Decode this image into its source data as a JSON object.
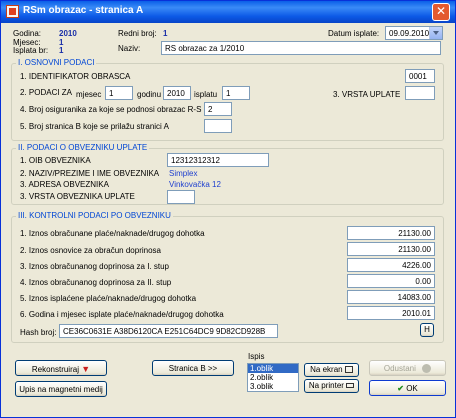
{
  "window": {
    "title": "RSm obrazac - stranica A",
    "close_label": "✕"
  },
  "header": {
    "godina_label": "Godina:",
    "godina_value": "2010",
    "mjesec_label": "Mjesec:",
    "mjesec_value": "1",
    "isplata_label": "Isplata br:",
    "isplata_value": "1",
    "redni_label": "Redni broj:",
    "redni_value": "1",
    "naziv_label": "Naziv:",
    "naziv_value": "RS obrazac za 1/2010",
    "datum_label": "Datum isplate:",
    "datum_value": "09.09.2010"
  },
  "section1": {
    "title": "I. OSNOVNI PODACI",
    "identifikator_label": "1. IDENTIFIKATOR OBRASCA",
    "identifikator_value": "0001",
    "podaci_label": "2. PODACI ZA",
    "mjesec_label": "mjesec",
    "mjesec_value": "1",
    "godinu_label": "godinu",
    "godinu_value": "2010",
    "isplatu_label": "isplatu",
    "isplatu_value": "1",
    "vrsta_label": "3. VRSTA UPLATE",
    "vrsta_value": "",
    "osiguranika_label": "4. Broj osiguranika za koje se podnosi obrazac R-S",
    "osiguranika_value": "2",
    "stranica_b_label": "5. Broj stranica B koje se prilažu stranici A",
    "stranica_b_value": ""
  },
  "section2": {
    "title": "II. PODACI O OBVEZNIKU UPLATE",
    "oib_label": "1. OIB OBVEZNIKA",
    "oib_value": "12312312312",
    "naziv_label": "2. NAZIV/PREZIME I IME OBVEZNIKA",
    "naziv_value": "Simplex",
    "adresa_label": "3. ADRESA OBVEZNIKA",
    "adresa_value": "Vinkovačka 12",
    "vrsta_label": "3. VRSTA OBVEZNIKA UPLATE",
    "vrsta_value": ""
  },
  "section3": {
    "title": "III. KONTROLNI PODACI PO OBVEZNIKU",
    "rows": [
      {
        "label": "1.   Iznos obračunane plaće/naknade/drugog dohotka",
        "value": "21130.00"
      },
      {
        "label": "2.   Iznos osnovice za obračun doprinosa",
        "value": "21130.00"
      },
      {
        "label": "3.   Iznos obračunanog doprinosa za I. stup",
        "value": "4226.00"
      },
      {
        "label": "4.   Iznos obračunanog doprinosa za II. stup",
        "value": "0.00"
      },
      {
        "label": "5.   Iznos isplaćene plaće/naknade/drugog dohotka",
        "value": "14083.00"
      },
      {
        "label": "6.   Godina i mjesec isplate plaće/naknade/drugog dohotka",
        "value": "2010.01"
      }
    ],
    "hash_label": "Hash broj:",
    "hash_value": "CE36C0631E A38D6120CA E251C64DC9 9D82CD928B",
    "hash_button": "H"
  },
  "footer": {
    "rekonstruiraj": "Rekonstruiraj",
    "upis": "Upis na magnetni medij",
    "stranica_b": "Stranica B >>",
    "ispis_label": "Ispis",
    "ispis_options": [
      "1.oblik",
      "2.oblik",
      "3.oblik"
    ],
    "na_ekran": "Na ekran",
    "na_printer": "Na printer",
    "odustani": "Odustani",
    "ok": "OK"
  }
}
